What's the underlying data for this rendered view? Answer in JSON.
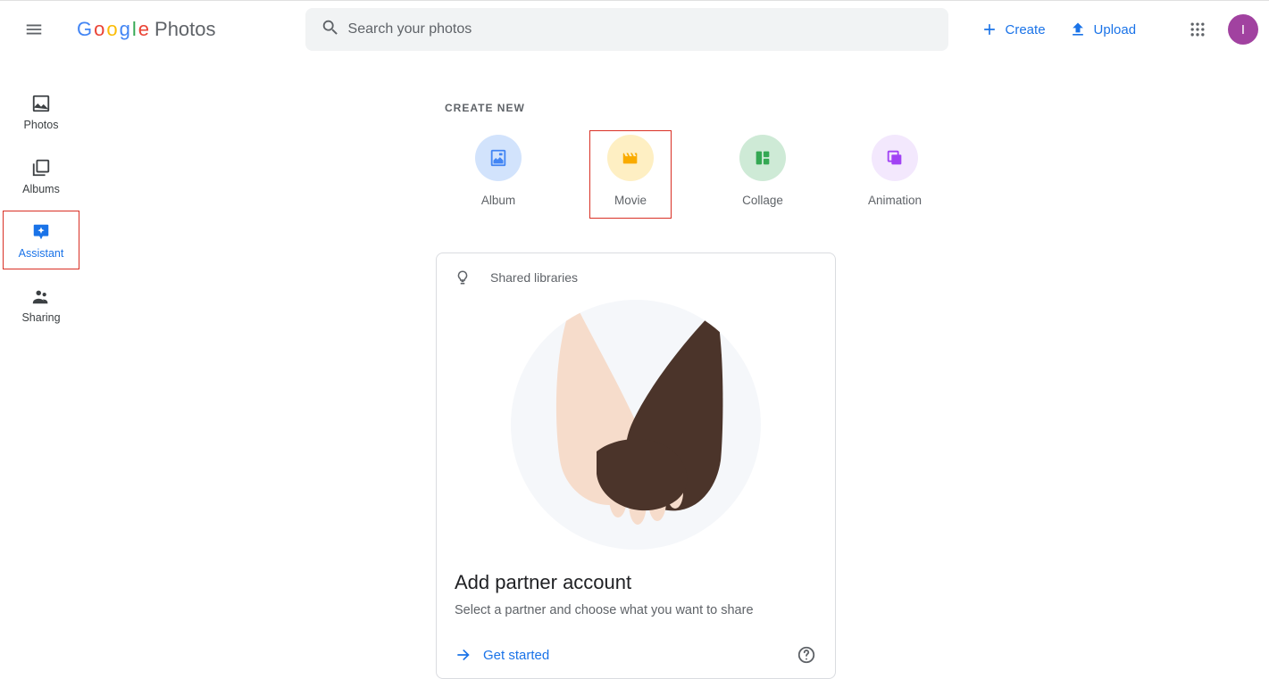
{
  "header": {
    "logo_product": "Photos",
    "search_placeholder": "Search your photos",
    "create_label": "Create",
    "upload_label": "Upload",
    "avatar_initial": "I"
  },
  "sidebar": {
    "items": [
      {
        "key": "photos",
        "label": "Photos"
      },
      {
        "key": "albums",
        "label": "Albums"
      },
      {
        "key": "assistant",
        "label": "Assistant",
        "active": true
      },
      {
        "key": "sharing",
        "label": "Sharing"
      }
    ]
  },
  "create_section": {
    "heading": "CREATE NEW",
    "items": [
      {
        "key": "album",
        "label": "Album",
        "color": "blue"
      },
      {
        "key": "movie",
        "label": "Movie",
        "color": "yellow",
        "highlight": true
      },
      {
        "key": "collage",
        "label": "Collage",
        "color": "green"
      },
      {
        "key": "animation",
        "label": "Animation",
        "color": "purple"
      }
    ]
  },
  "card": {
    "tag": "Shared libraries",
    "title": "Add partner account",
    "subtitle": "Select a partner and choose what you want to share",
    "cta": "Get started"
  }
}
